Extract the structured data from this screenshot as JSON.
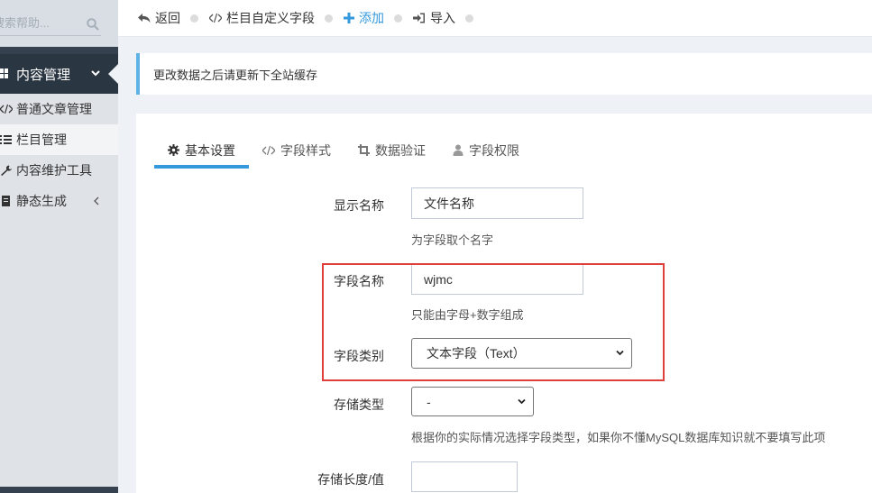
{
  "sidebar": {
    "search_placeholder": "搜索帮助...",
    "active_menu": {
      "label": "内容管理",
      "icon": "grid-icon"
    },
    "items": [
      {
        "label": "普通文章管理",
        "icon": "code-icon"
      },
      {
        "label": "栏目管理",
        "icon": "list-icon"
      },
      {
        "label": "内容维护工具",
        "icon": "wrench-icon"
      },
      {
        "label": "静态生成",
        "icon": "file-icon"
      }
    ]
  },
  "toolbar": {
    "back": "返回",
    "custom_fields": "栏目自定义字段",
    "add": "添加",
    "import": "导入"
  },
  "notice": "更改数据之后请更新下全站缓存",
  "tabs": [
    {
      "label": "基本设置",
      "icon": "gear-icon"
    },
    {
      "label": "字段样式",
      "icon": "code-icon"
    },
    {
      "label": "数据验证",
      "icon": "crop-icon"
    },
    {
      "label": "字段权限",
      "icon": "user-icon"
    }
  ],
  "form": {
    "display_name": {
      "label": "显示名称",
      "value": "文件名称",
      "help": "为字段取个名字"
    },
    "field_name": {
      "label": "字段名称",
      "value": "wjmc",
      "help": "只能由字母+数字组成"
    },
    "field_type": {
      "label": "字段类别",
      "value": "文本字段（Text）"
    },
    "storage_type": {
      "label": "存储类型",
      "value": "-",
      "help": "根据你的实际情况选择字段类型，如果你不懂MySQL数据库知识就不要填写此项"
    },
    "storage_length": {
      "label": "存储长度/值",
      "value": ""
    }
  },
  "colors": {
    "accent": "#3598dc",
    "highlight": "#e0403b",
    "sidebar_active": "#2b3643"
  }
}
